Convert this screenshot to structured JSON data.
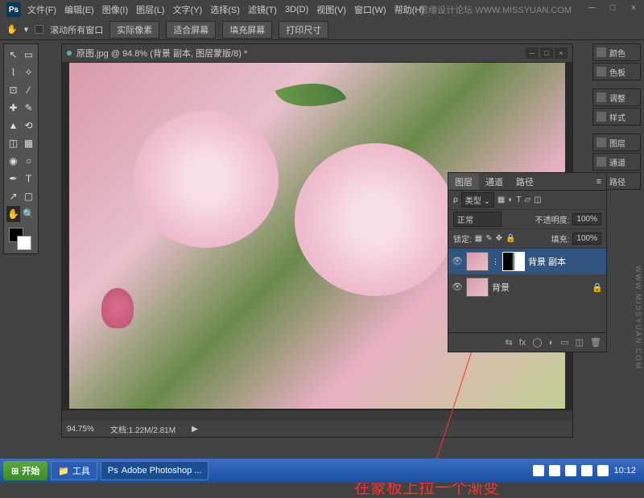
{
  "app": {
    "logo": "Ps"
  },
  "menu": [
    "文件(F)",
    "编辑(E)",
    "图像(I)",
    "图层(L)",
    "文字(Y)",
    "选择(S)",
    "滤镜(T)",
    "3D(D)",
    "视图(V)",
    "窗口(W)",
    "帮助(H)"
  ],
  "watermark": "思缘设计论坛  WWW.MISSYUAN.COM",
  "vertical_watermark": "WWW.MISSYUAN.COM",
  "options": {
    "scroll_all": "滚动所有窗口",
    "actual_pixels": "实际像素",
    "fit_screen": "适合屏幕",
    "fill_screen": "填充屏幕",
    "print_size": "打印尺寸"
  },
  "document": {
    "title": "原图.jpg @ 94.8% (背景 副本, 图层蒙版/8) *",
    "zoom": "94.75%",
    "doc_size": "文档:1.22M/2.81M"
  },
  "right_panels": {
    "color": "颜色",
    "swatches": "色板",
    "adjustments": "调整",
    "styles": "样式",
    "layers": "图层",
    "channels": "通道",
    "paths": "路径"
  },
  "layers_panel": {
    "tab_layers": "图层",
    "tab_channels": "通道",
    "tab_paths": "路径",
    "kind": "类型",
    "blend": "正常",
    "opacity_label": "不透明度:",
    "opacity": "100%",
    "lock_label": "锁定:",
    "fill_label": "填充:",
    "fill": "100%",
    "layer1": "背景 副本",
    "layer2": "背景"
  },
  "annotation": "在蒙板上拉一个渐变",
  "taskbar": {
    "start": "开始",
    "item1": "工具",
    "item2": "Adobe Photoshop ...",
    "time": "10:12"
  }
}
